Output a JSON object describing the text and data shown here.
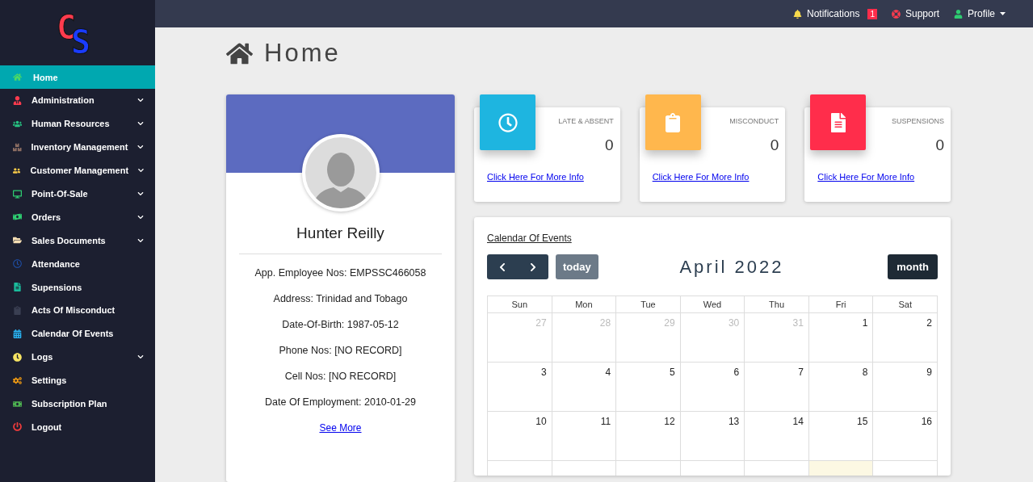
{
  "sidebar": {
    "logo": {
      "letters": [
        "C",
        "S"
      ]
    },
    "items": [
      {
        "label": "Home",
        "selected": true,
        "expandable": false
      },
      {
        "label": "Administration",
        "selected": false,
        "expandable": true
      },
      {
        "label": "Human Resources",
        "selected": false,
        "expandable": true
      },
      {
        "label": "Inventory Management",
        "selected": false,
        "expandable": true
      },
      {
        "label": "Customer Management",
        "selected": false,
        "expandable": true
      },
      {
        "label": "Point-Of-Sale",
        "selected": false,
        "expandable": true
      },
      {
        "label": "Orders",
        "selected": false,
        "expandable": true
      },
      {
        "label": "Sales Documents",
        "selected": false,
        "expandable": true
      },
      {
        "label": "Attendance",
        "selected": false,
        "expandable": false
      },
      {
        "label": "Supensions",
        "selected": false,
        "expandable": false
      },
      {
        "label": "Acts Of Misconduct",
        "selected": false,
        "expandable": false
      },
      {
        "label": "Calendar Of Events",
        "selected": false,
        "expandable": false
      },
      {
        "label": "Logs",
        "selected": false,
        "expandable": true
      },
      {
        "label": "Settings",
        "selected": false,
        "expandable": false
      },
      {
        "label": "Subscription Plan",
        "selected": false,
        "expandable": false
      },
      {
        "label": "Logout",
        "selected": false,
        "expandable": false
      }
    ]
  },
  "topbar": {
    "notifications": {
      "label": "Notifications",
      "count": "1"
    },
    "support": {
      "label": "Support"
    },
    "profile": {
      "label": "Profile"
    }
  },
  "page_title": "Home",
  "profile_card": {
    "name": "Hunter Reilly",
    "details": [
      "App. Employee Nos: EMPSSC466058",
      "Address: Trinidad and Tobago",
      "Date-Of-Birth: 1987-05-12",
      "Phone Nos: [NO RECORD]",
      "Cell Nos: [NO RECORD]",
      "Date Of Employment: 2010-01-29"
    ],
    "link": "See More"
  },
  "stats": [
    {
      "title": "LATE & ABSENT",
      "value": "0",
      "link": "Click Here For More Info",
      "color": "#1eb5e0"
    },
    {
      "title": "MISCONDUCT",
      "value": "0",
      "link": "Click Here For More Info",
      "color": "#ffb74d"
    },
    {
      "title": "SUSPENSIONS",
      "value": "0",
      "link": "Click Here For More Info",
      "color": "#ff2d4b"
    }
  ],
  "calendar": {
    "title": "Calendar Of Events",
    "today_button": "today",
    "month_title": "April 2022",
    "view_button": "month",
    "weekdays": [
      "Sun",
      "Mon",
      "Tue",
      "Wed",
      "Thu",
      "Fri",
      "Sat"
    ],
    "weeks": [
      [
        {
          "day": "27",
          "muted": true,
          "today": false
        },
        {
          "day": "28",
          "muted": true,
          "today": false
        },
        {
          "day": "29",
          "muted": true,
          "today": false
        },
        {
          "day": "30",
          "muted": true,
          "today": false
        },
        {
          "day": "31",
          "muted": true,
          "today": false
        },
        {
          "day": "1",
          "muted": false,
          "today": false
        },
        {
          "day": "2",
          "muted": false,
          "today": false
        }
      ],
      [
        {
          "day": "3",
          "muted": false,
          "today": false
        },
        {
          "day": "4",
          "muted": false,
          "today": false
        },
        {
          "day": "5",
          "muted": false,
          "today": false
        },
        {
          "day": "6",
          "muted": false,
          "today": false
        },
        {
          "day": "7",
          "muted": false,
          "today": false
        },
        {
          "day": "8",
          "muted": false,
          "today": false
        },
        {
          "day": "9",
          "muted": false,
          "today": false
        }
      ],
      [
        {
          "day": "10",
          "muted": false,
          "today": false
        },
        {
          "day": "11",
          "muted": false,
          "today": false
        },
        {
          "day": "12",
          "muted": false,
          "today": false
        },
        {
          "day": "13",
          "muted": false,
          "today": false
        },
        {
          "day": "14",
          "muted": false,
          "today": false
        },
        {
          "day": "15",
          "muted": false,
          "today": false
        },
        {
          "day": "16",
          "muted": false,
          "today": false
        }
      ],
      [
        {
          "today": false
        },
        {
          "today": false
        },
        {
          "today": false
        },
        {
          "today": false
        },
        {
          "today": false
        },
        {
          "today": true
        },
        {
          "today": false
        }
      ]
    ]
  }
}
